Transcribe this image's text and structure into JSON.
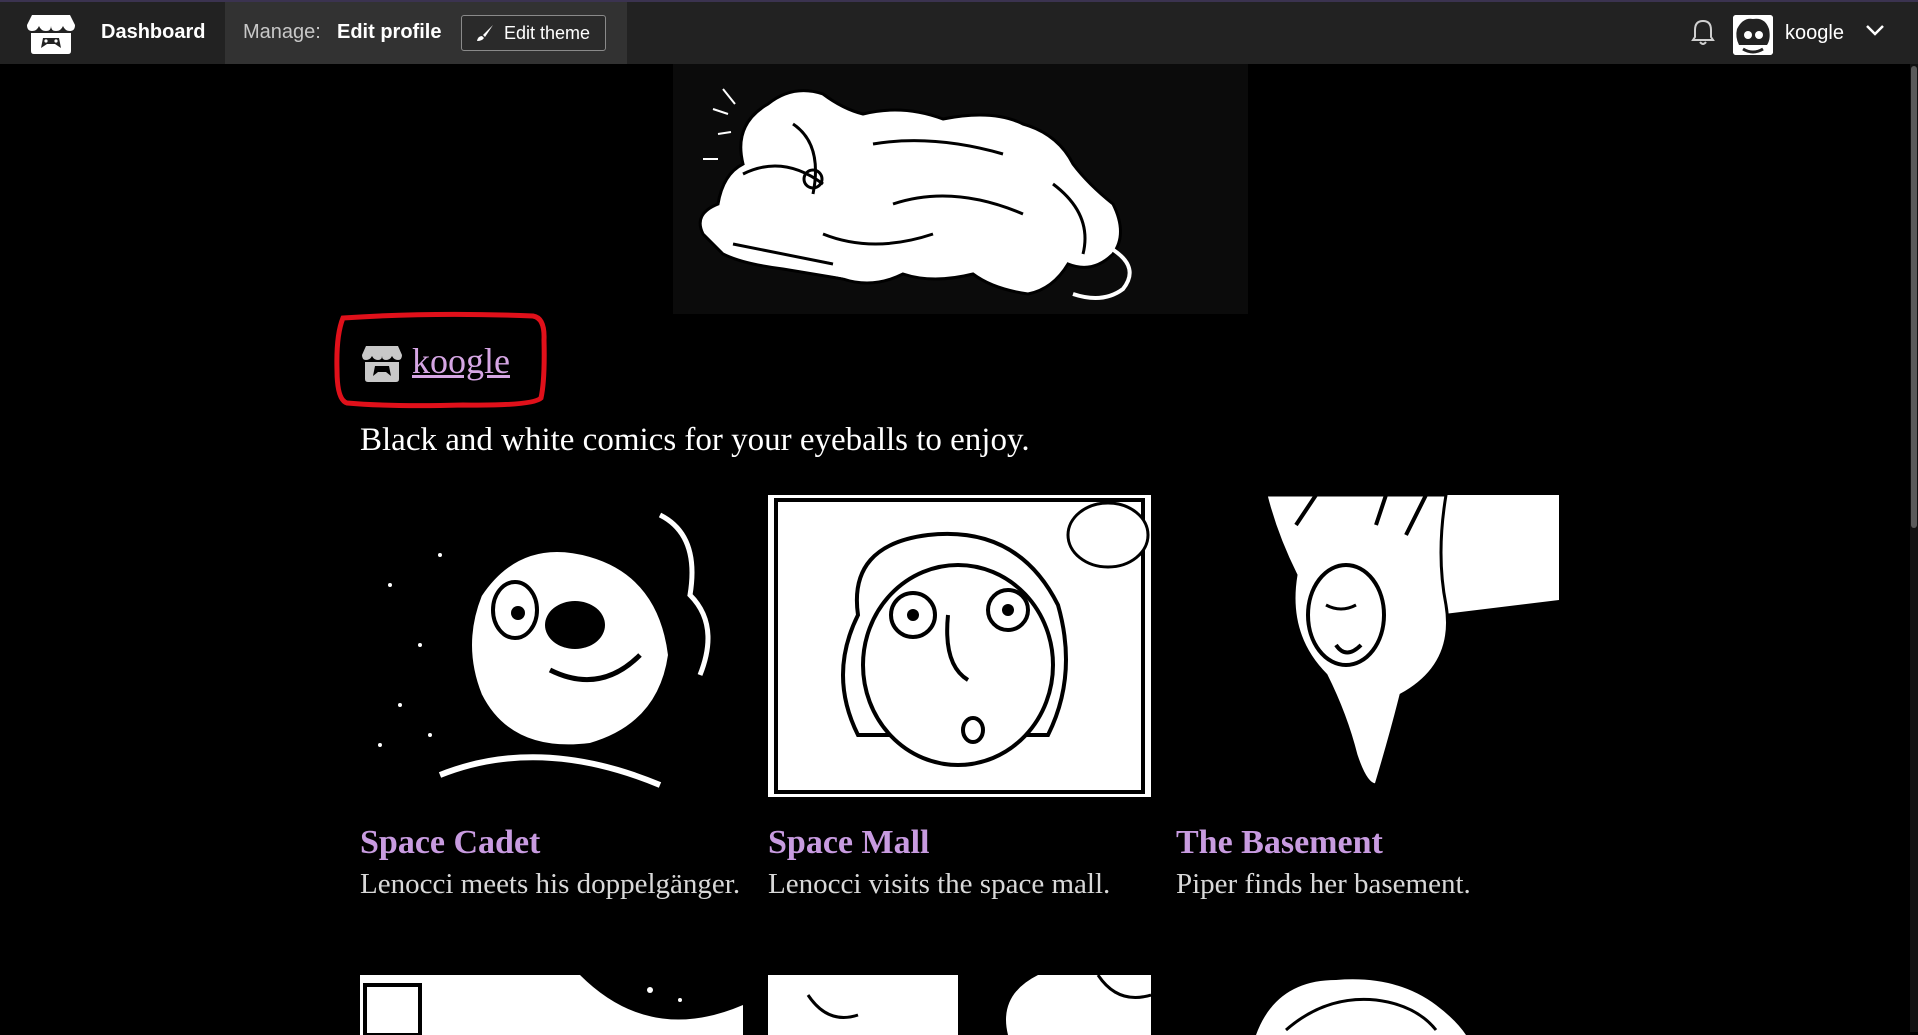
{
  "nav": {
    "dashboard_label": "Dashboard",
    "manage_label": "Manage:",
    "edit_profile_label": "Edit profile",
    "edit_theme_label": "Edit theme",
    "username": "koogle",
    "icons": [
      "itchio-logo-icon",
      "brush-icon",
      "bell-icon",
      "chevron-down-icon"
    ]
  },
  "profile": {
    "name": "koogle",
    "tagline": "Black and white comics for your eyeballs to enjoy.",
    "link_color": "#d6a6e4"
  },
  "games": [
    {
      "title": "Space Cadet",
      "description": "Lenocci meets his doppelgänger."
    },
    {
      "title": "Space Mall",
      "description": "Lenocci visits the space mall."
    },
    {
      "title": "The Basement",
      "description": "Piper finds her basement."
    }
  ],
  "colors": {
    "background": "#000000",
    "topbar": "#222222",
    "title_accent": "#c89be0",
    "highlight_circle": "#e0101a"
  }
}
